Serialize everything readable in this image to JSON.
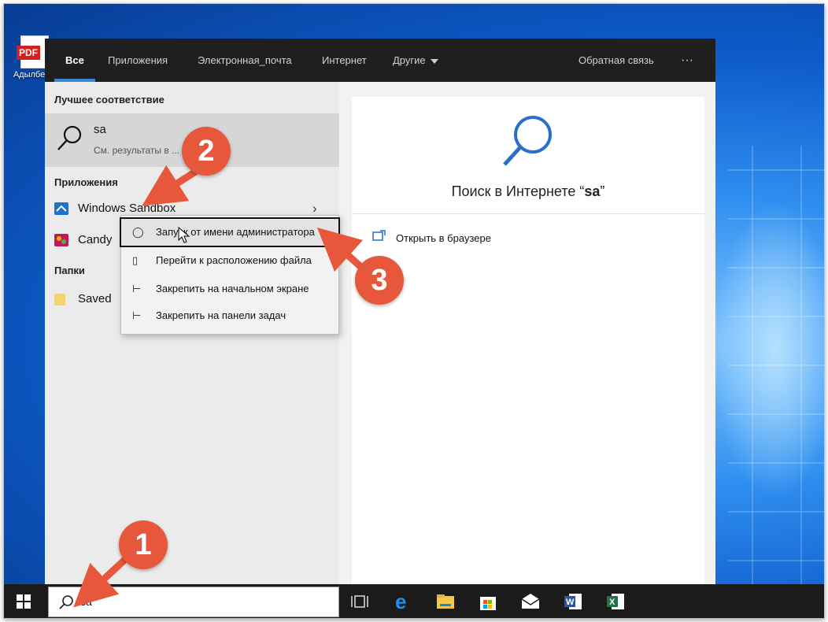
{
  "desktop": {
    "icon_label": "Адылбе",
    "pdf_tag": "PDF"
  },
  "tabs": [
    {
      "label": "Все"
    },
    {
      "label": "Приложения"
    },
    {
      "label": "Электронная_почта"
    },
    {
      "label": "Интернет"
    },
    {
      "label": "Другие"
    }
  ],
  "feedback_label": "Обратная связь",
  "more_label": "···",
  "best_match": {
    "heading": "Лучшее соответствие",
    "title": "sa",
    "subtitle": "См. результаты в ... е"
  },
  "apps": {
    "heading": "Приложения",
    "items": [
      {
        "label": "Windows Sandbox"
      },
      {
        "label": "Candy"
      }
    ]
  },
  "folders": {
    "heading": "Папки",
    "items": [
      {
        "label": "Saved"
      }
    ]
  },
  "context_menu": {
    "items": [
      {
        "label": "Запуск от имени администратора",
        "icon": "shield-run-icon"
      },
      {
        "label": "Перейти к расположению файла",
        "icon": "file-location-icon"
      },
      {
        "label": "Закрепить на начальном экране",
        "icon": "pin-icon"
      },
      {
        "label": "Закрепить на панели задач",
        "icon": "pin-icon"
      }
    ]
  },
  "web_panel": {
    "title_prefix": "Поиск в Интернете “",
    "query": "sa",
    "title_suffix": "”",
    "open_browser": "Открыть в браузере"
  },
  "taskbar": {
    "search_value": "sa",
    "icons": [
      "task-view-icon",
      "edge-icon",
      "file-explorer-icon",
      "store-icon",
      "mail-icon",
      "word-icon",
      "excel-icon"
    ]
  },
  "annotations": {
    "badges": [
      "1",
      "2",
      "3"
    ]
  },
  "colors": {
    "accent": "#3a86d6",
    "badge": "#e7573b",
    "panel_dark": "#1f1f1f"
  }
}
